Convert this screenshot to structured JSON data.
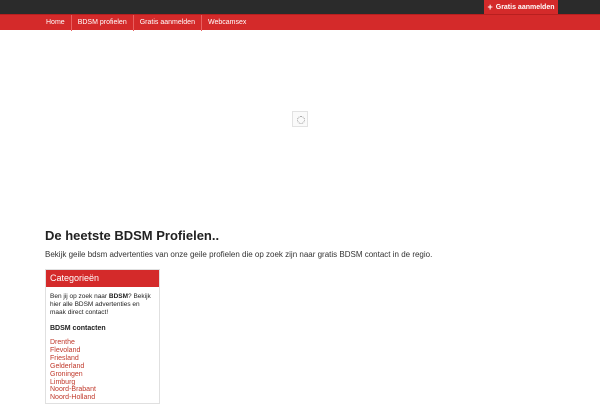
{
  "topbar": {
    "signup_label": "Gratis aanmelden"
  },
  "nav": {
    "items": [
      {
        "label": "Home"
      },
      {
        "label": "BDSM profielen"
      },
      {
        "label": "Gratis aanmelden"
      },
      {
        "label": "Webcamsex"
      }
    ]
  },
  "main": {
    "heading": "De heetste BDSM Profielen..",
    "intro": "Bekijk geile bdsm advertenties van onze geile profielen die op zoek zijn naar gratis BDSM contact in de regio."
  },
  "categories": {
    "title": "Categorieën",
    "desc_before": "Ben jij op zoek naar ",
    "desc_bold": "BDSM",
    "desc_after": "? Bekijk hier alle BDSM advertenties en maak direct contact!",
    "subheading": "BDSM contacten",
    "provinces": [
      {
        "label": "Drenthe"
      },
      {
        "label": "Flevoland"
      },
      {
        "label": "Friesland"
      },
      {
        "label": "Gelderland"
      },
      {
        "label": "Groningen"
      },
      {
        "label": "Limburg"
      },
      {
        "label": "Noord-Brabant"
      },
      {
        "label": "Noord-Holland"
      }
    ]
  },
  "colors": {
    "brand_red": "#d42a2a",
    "topbar": "#2b2b2b",
    "link_red": "#c0392b"
  }
}
